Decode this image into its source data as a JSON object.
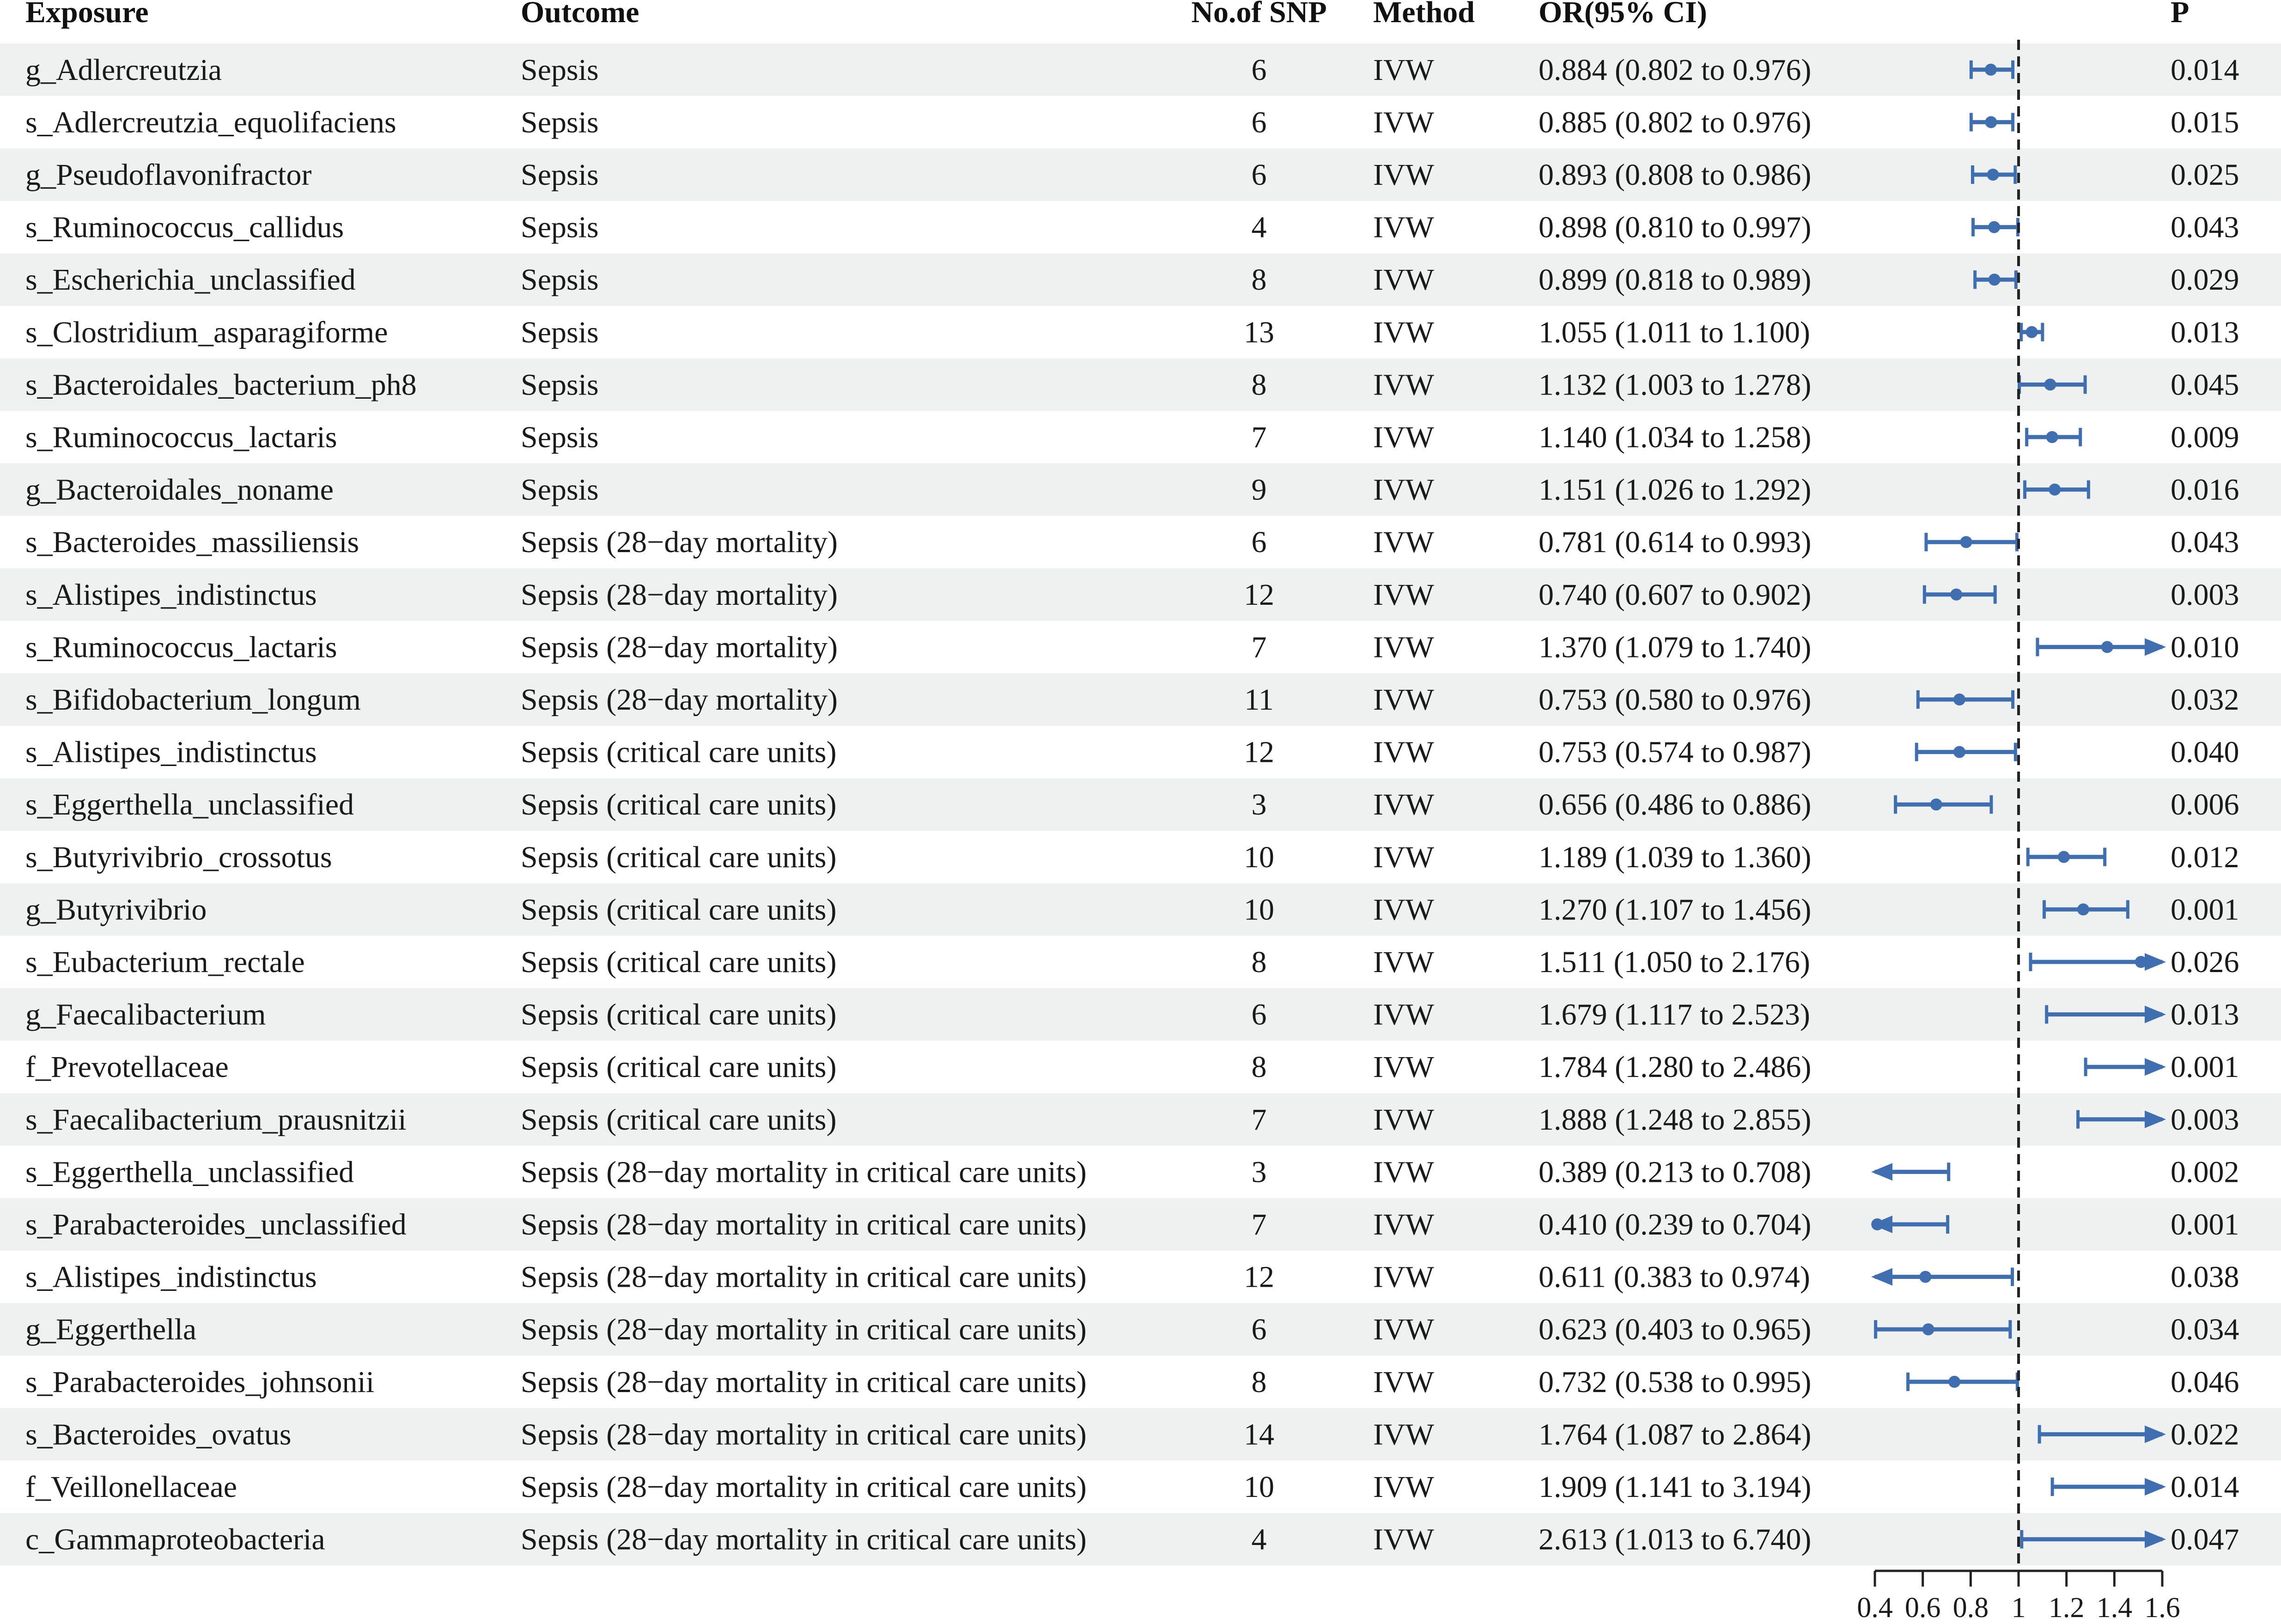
{
  "chart_data": {
    "type": "forest",
    "columns": {
      "exposure": "Exposure",
      "outcome": "Outcome",
      "nsnp": "No.of SNP",
      "method": "Method",
      "or_ci": "OR(95% CI)",
      "p": "P"
    },
    "x_axis": {
      "ticks": [
        0.4,
        0.6,
        0.8,
        1,
        1.2,
        1.4,
        1.6
      ],
      "tick_labels": [
        "0.4",
        "0.6",
        "0.8",
        "1",
        "1.2",
        "1.4",
        "1.6"
      ],
      "xlim": [
        0.4,
        1.6
      ],
      "reference_line": 1
    },
    "colors": {
      "point": "#3f6fb0",
      "stripe": "#eef1f0",
      "text": "#1a1a1a"
    },
    "rows": [
      {
        "exposure": "g_Adlercreutzia",
        "outcome": "Sepsis",
        "nsnp": "6",
        "method": "IVW",
        "or": 0.884,
        "lower": 0.802,
        "upper": 0.976,
        "or_ci": "0.884 (0.802 to 0.976)",
        "p": "0.014"
      },
      {
        "exposure": "s_Adlercreutzia_equolifaciens",
        "outcome": "Sepsis",
        "nsnp": "6",
        "method": "IVW",
        "or": 0.885,
        "lower": 0.802,
        "upper": 0.976,
        "or_ci": "0.885 (0.802 to 0.976)",
        "p": "0.015"
      },
      {
        "exposure": "g_Pseudoflavonifractor",
        "outcome": "Sepsis",
        "nsnp": "6",
        "method": "IVW",
        "or": 0.893,
        "lower": 0.808,
        "upper": 0.986,
        "or_ci": "0.893 (0.808 to 0.986)",
        "p": "0.025"
      },
      {
        "exposure": "s_Ruminococcus_callidus",
        "outcome": "Sepsis",
        "nsnp": "4",
        "method": "IVW",
        "or": 0.898,
        "lower": 0.81,
        "upper": 0.997,
        "or_ci": "0.898 (0.810 to 0.997)",
        "p": "0.043"
      },
      {
        "exposure": "s_Escherichia_unclassified",
        "outcome": "Sepsis",
        "nsnp": "8",
        "method": "IVW",
        "or": 0.899,
        "lower": 0.818,
        "upper": 0.989,
        "or_ci": "0.899 (0.818 to 0.989)",
        "p": "0.029"
      },
      {
        "exposure": "s_Clostridium_asparagiforme",
        "outcome": "Sepsis",
        "nsnp": "13",
        "method": "IVW",
        "or": 1.055,
        "lower": 1.011,
        "upper": 1.1,
        "or_ci": "1.055 (1.011 to 1.100)",
        "p": "0.013"
      },
      {
        "exposure": "s_Bacteroidales_bacterium_ph8",
        "outcome": "Sepsis",
        "nsnp": "8",
        "method": "IVW",
        "or": 1.132,
        "lower": 1.003,
        "upper": 1.278,
        "or_ci": "1.132 (1.003 to 1.278)",
        "p": "0.045"
      },
      {
        "exposure": "s_Ruminococcus_lactaris",
        "outcome": "Sepsis",
        "nsnp": "7",
        "method": "IVW",
        "or": 1.14,
        "lower": 1.034,
        "upper": 1.258,
        "or_ci": "1.140 (1.034 to 1.258)",
        "p": "0.009"
      },
      {
        "exposure": "g_Bacteroidales_noname",
        "outcome": "Sepsis",
        "nsnp": "9",
        "method": "IVW",
        "or": 1.151,
        "lower": 1.026,
        "upper": 1.292,
        "or_ci": "1.151 (1.026 to 1.292)",
        "p": "0.016"
      },
      {
        "exposure": "s_Bacteroides_massiliensis",
        "outcome": "Sepsis (28−day mortality)",
        "nsnp": "6",
        "method": "IVW",
        "or": 0.781,
        "lower": 0.614,
        "upper": 0.993,
        "or_ci": "0.781 (0.614 to 0.993)",
        "p": "0.043"
      },
      {
        "exposure": "s_Alistipes_indistinctus",
        "outcome": "Sepsis (28−day mortality)",
        "nsnp": "12",
        "method": "IVW",
        "or": 0.74,
        "lower": 0.607,
        "upper": 0.902,
        "or_ci": "0.740 (0.607 to 0.902)",
        "p": "0.003"
      },
      {
        "exposure": "s_Ruminococcus_lactaris",
        "outcome": "Sepsis (28−day mortality)",
        "nsnp": "7",
        "method": "IVW",
        "or": 1.37,
        "lower": 1.079,
        "upper": 1.74,
        "or_ci": "1.370 (1.079 to 1.740)",
        "p": "0.010"
      },
      {
        "exposure": "s_Bifidobacterium_longum",
        "outcome": "Sepsis (28−day mortality)",
        "nsnp": "11",
        "method": "IVW",
        "or": 0.753,
        "lower": 0.58,
        "upper": 0.976,
        "or_ci": "0.753 (0.580 to 0.976)",
        "p": "0.032"
      },
      {
        "exposure": "s_Alistipes_indistinctus",
        "outcome": "Sepsis (critical care units)",
        "nsnp": "12",
        "method": "IVW",
        "or": 0.753,
        "lower": 0.574,
        "upper": 0.987,
        "or_ci": "0.753 (0.574 to 0.987)",
        "p": "0.040"
      },
      {
        "exposure": "s_Eggerthella_unclassified",
        "outcome": "Sepsis (critical care units)",
        "nsnp": "3",
        "method": "IVW",
        "or": 0.656,
        "lower": 0.486,
        "upper": 0.886,
        "or_ci": "0.656 (0.486 to 0.886)",
        "p": "0.006"
      },
      {
        "exposure": "s_Butyrivibrio_crossotus",
        "outcome": "Sepsis (critical care units)",
        "nsnp": "10",
        "method": "IVW",
        "or": 1.189,
        "lower": 1.039,
        "upper": 1.36,
        "or_ci": "1.189 (1.039 to 1.360)",
        "p": "0.012"
      },
      {
        "exposure": "g_Butyrivibrio",
        "outcome": "Sepsis (critical care units)",
        "nsnp": "10",
        "method": "IVW",
        "or": 1.27,
        "lower": 1.107,
        "upper": 1.456,
        "or_ci": "1.270 (1.107 to 1.456)",
        "p": "0.001"
      },
      {
        "exposure": "s_Eubacterium_rectale",
        "outcome": "Sepsis (critical care units)",
        "nsnp": "8",
        "method": "IVW",
        "or": 1.511,
        "lower": 1.05,
        "upper": 2.176,
        "or_ci": "1.511 (1.050 to 2.176)",
        "p": "0.026"
      },
      {
        "exposure": "g_Faecalibacterium",
        "outcome": "Sepsis (critical care units)",
        "nsnp": "6",
        "method": "IVW",
        "or": 1.679,
        "lower": 1.117,
        "upper": 2.523,
        "or_ci": "1.679 (1.117 to 2.523)",
        "p": "0.013"
      },
      {
        "exposure": "f_Prevotellaceae",
        "outcome": "Sepsis (critical care units)",
        "nsnp": "8",
        "method": "IVW",
        "or": 1.784,
        "lower": 1.28,
        "upper": 2.486,
        "or_ci": "1.784 (1.280 to 2.486)",
        "p": "0.001"
      },
      {
        "exposure": "s_Faecalibacterium_prausnitzii",
        "outcome": "Sepsis (critical care units)",
        "nsnp": "7",
        "method": "IVW",
        "or": 1.888,
        "lower": 1.248,
        "upper": 2.855,
        "or_ci": "1.888 (1.248 to 2.855)",
        "p": "0.003"
      },
      {
        "exposure": "s_Eggerthella_unclassified",
        "outcome": "Sepsis (28−day mortality in critical care units)",
        "nsnp": "3",
        "method": "IVW",
        "or": 0.389,
        "lower": 0.213,
        "upper": 0.708,
        "or_ci": "0.389 (0.213 to 0.708)",
        "p": "0.002"
      },
      {
        "exposure": "s_Parabacteroides_unclassified",
        "outcome": "Sepsis (28−day mortality in critical care units)",
        "nsnp": "7",
        "method": "IVW",
        "or": 0.41,
        "lower": 0.239,
        "upper": 0.704,
        "or_ci": "0.410 (0.239 to 0.704)",
        "p": "0.001"
      },
      {
        "exposure": "s_Alistipes_indistinctus",
        "outcome": "Sepsis (28−day mortality in critical care units)",
        "nsnp": "12",
        "method": "IVW",
        "or": 0.611,
        "lower": 0.383,
        "upper": 0.974,
        "or_ci": "0.611 (0.383 to 0.974)",
        "p": "0.038"
      },
      {
        "exposure": "g_Eggerthella",
        "outcome": "Sepsis (28−day mortality in critical care units)",
        "nsnp": "6",
        "method": "IVW",
        "or": 0.623,
        "lower": 0.403,
        "upper": 0.965,
        "or_ci": "0.623 (0.403 to 0.965)",
        "p": "0.034"
      },
      {
        "exposure": "s_Parabacteroides_johnsonii",
        "outcome": "Sepsis (28−day mortality in critical care units)",
        "nsnp": "8",
        "method": "IVW",
        "or": 0.732,
        "lower": 0.538,
        "upper": 0.995,
        "or_ci": "0.732 (0.538 to 0.995)",
        "p": "0.046"
      },
      {
        "exposure": "s_Bacteroides_ovatus",
        "outcome": "Sepsis (28−day mortality in critical care units)",
        "nsnp": "14",
        "method": "IVW",
        "or": 1.764,
        "lower": 1.087,
        "upper": 2.864,
        "or_ci": "1.764 (1.087 to 2.864)",
        "p": "0.022"
      },
      {
        "exposure": "f_Veillonellaceae",
        "outcome": "Sepsis (28−day mortality in critical care units)",
        "nsnp": "10",
        "method": "IVW",
        "or": 1.909,
        "lower": 1.141,
        "upper": 3.194,
        "or_ci": "1.909 (1.141 to 3.194)",
        "p": "0.014"
      },
      {
        "exposure": "c_Gammaproteobacteria",
        "outcome": "Sepsis (28−day mortality in critical care units)",
        "nsnp": "4",
        "method": "IVW",
        "or": 2.613,
        "lower": 1.013,
        "upper": 6.74,
        "or_ci": "2.613 (1.013 to 6.740)",
        "p": "0.047"
      }
    ]
  }
}
